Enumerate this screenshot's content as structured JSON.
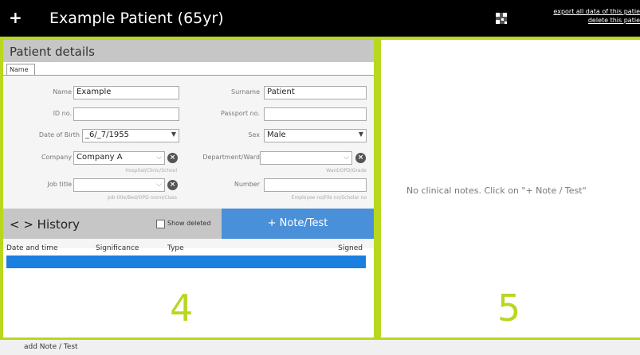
{
  "header": {
    "add_icon": "+",
    "title": "Example Patient (65yr)",
    "qr_icon": "qr-code-icon",
    "link_export": "export all data of this patie",
    "link_delete": "delete this patie"
  },
  "patient": {
    "heading": "Patient details",
    "tab": "Name",
    "name_label": "Name",
    "name_value": "Example",
    "surname_label": "Surname",
    "surname_value": "Patient",
    "id_label": "ID no.",
    "id_value": "",
    "passport_label": "Passport no.",
    "passport_value": "",
    "dob_label": "Date of Birth",
    "dob_value": "_6/_7/1955",
    "sex_label": "Sex",
    "sex_value": "Male",
    "company_label": "Company",
    "company_value": "Company A",
    "company_hint": "Hospital/Clinic/School",
    "dept_label": "Department/Ward",
    "dept_value": "",
    "dept_hint": "Ward/OPD/Grade",
    "job_label": "Job title",
    "job_value": "",
    "job_hint": "Job title/Bed/OPD room/Class",
    "number_label": "Number",
    "number_value": "",
    "number_hint": "Employee no/File no/Scholar no"
  },
  "history": {
    "heading": "< > History",
    "show_deleted": "Show deleted",
    "note_button": "+ Note/Test",
    "columns": [
      "Date and time",
      "Significance",
      "Type",
      "Signed"
    ],
    "panel_number": "4"
  },
  "notes": {
    "empty_message": "No clinical notes. Click on \"+ Note / Test\"",
    "panel_number": "5"
  },
  "footer": {
    "text": "add Note / Test"
  },
  "colors": {
    "accent": "#b8d820",
    "selection": "#1b7fe0",
    "button": "#4a90d9"
  }
}
